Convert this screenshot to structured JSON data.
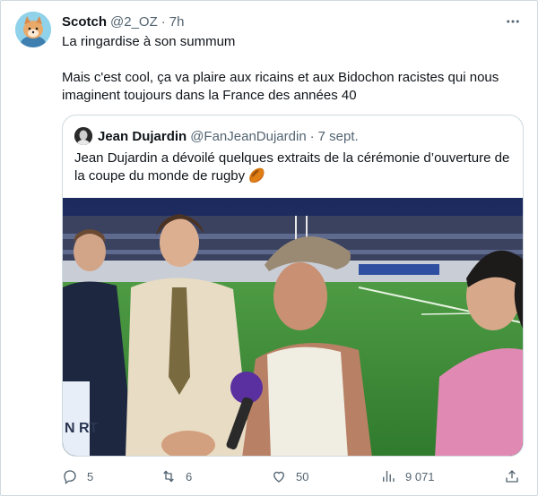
{
  "tweet": {
    "author_name": "Scotch",
    "author_handle": "@2_OZ",
    "separator": "·",
    "time": "7h",
    "line1": "La ringardise à son summum",
    "line2": "Mais c'est cool, ça va plaire aux ricains et aux Bidochon racistes qui nous imaginent toujours dans la France des années 40"
  },
  "quote": {
    "author_name": "Jean Dujardin",
    "author_handle": "@FanJeanDujardin",
    "separator": "·",
    "time": "7 sept.",
    "text": "Jean Dujardin a dévoilé quelques extraits de la cérémonie d’ouverture de la coupe du monde de rugby",
    "emoji": "🏉",
    "media_overlay_text": "N RT"
  },
  "actions": {
    "reply_count": "5",
    "retweet_count": "6",
    "like_count": "50",
    "views_count": "9 071"
  },
  "icons": {
    "more": "more-horizontal-icon",
    "reply": "reply-icon",
    "retweet": "retweet-icon",
    "like": "heart-icon",
    "views": "views-icon",
    "share": "share-icon"
  },
  "colors": {
    "text": "#0f1419",
    "secondary": "#536471",
    "border": "#cfd9de",
    "pitch": "#3f8a3a",
    "stadium": "#1a2038"
  }
}
